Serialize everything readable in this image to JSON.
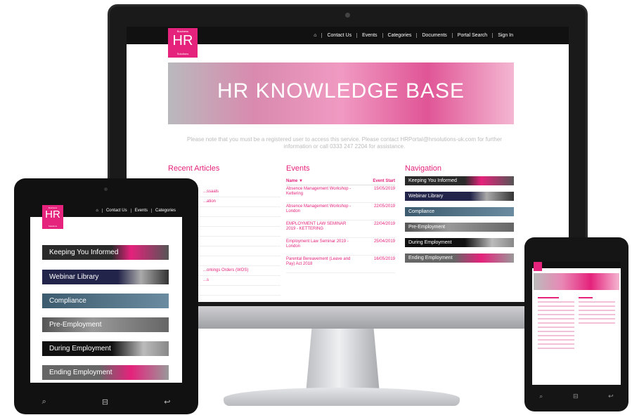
{
  "monitor": {
    "logo": {
      "small_top": "Business",
      "main": "HR",
      "small_bottom": "Solutions"
    },
    "nav": [
      "⌂",
      "Contact Us",
      "Events",
      "Categories",
      "Documents",
      "Portal Search",
      "Sign In"
    ],
    "hero_title": "HR KNOWLEDGE BASE",
    "note": "Please note that you must be a registered user to access this service. Please contact HRPortal@hrsolutions-uk.com for further information or call 0333 247 2204 for assistance.",
    "recent_articles": {
      "heading": "Recent Articles",
      "items": [
        "...ssaals",
        "...ation",
        "",
        "",
        "",
        "",
        "",
        "",
        "...orkings Orders (WOS)",
        "...s",
        ""
      ]
    },
    "events": {
      "heading": "Events",
      "col_name": "Name ▼",
      "col_start": "Event Start",
      "rows": [
        {
          "name": "Absence Management Workshop - Kettering",
          "start": "15/05/2019"
        },
        {
          "name": "Absence Management Workshop - London",
          "start": "22/05/2019"
        },
        {
          "name": "EMPLOYMENT LAW SEMINAR 2019 - KETTERING",
          "start": "22/04/2019"
        },
        {
          "name": "Employment Law Seminar 2019 - London",
          "start": "25/04/2019"
        },
        {
          "name": "Parental Bereavement (Leave and Pay) Act 2018",
          "start": "16/05/2019"
        }
      ]
    },
    "navigation": {
      "heading": "Navigation",
      "items": [
        "Keeping You Informed",
        "Webinar Library",
        "Compliance",
        "Pre-Employment",
        "During Employment",
        "Ending Employment"
      ]
    }
  },
  "tablet": {
    "logo": {
      "small_top": "Business",
      "main": "HR",
      "small_bottom": "Solutions"
    },
    "nav": [
      "⌂",
      "Contact Us",
      "Events",
      "Categories"
    ],
    "items": [
      "Keeping You Informed",
      "Webinar Library",
      "Compliance",
      "Pre-Employment",
      "During Employment",
      "Ending Employment"
    ],
    "buttons": [
      "⌕",
      "⊟",
      "↩"
    ]
  },
  "phone": {
    "buttons": [
      "⌕",
      "⊟",
      "↩"
    ]
  },
  "colors": {
    "brand": "#e5227c",
    "dark": "#111111"
  }
}
